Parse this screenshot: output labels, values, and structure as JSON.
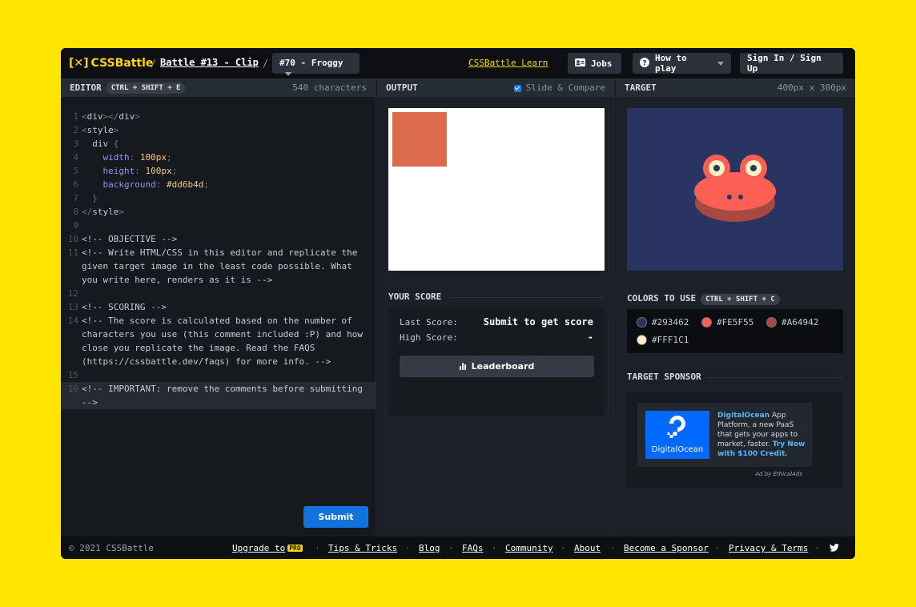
{
  "header": {
    "logo_text": "CSSBattle",
    "battle_link": "Battle #13 - Clip",
    "level_select": "#70 - Froggy",
    "learn_link": "CSSBattle Learn",
    "jobs_label": "Jobs",
    "how_to_play_label": "How to play",
    "sign_in_label": "Sign In / Sign Up"
  },
  "editor": {
    "title": "EDITOR",
    "shortcut": "CTRL + SHIFT + E",
    "char_count": "540 characters",
    "submit_label": "Submit",
    "lines": [
      {
        "n": "1"
      },
      {
        "n": "2"
      },
      {
        "n": "3"
      },
      {
        "n": "4"
      },
      {
        "n": "5"
      },
      {
        "n": "6"
      },
      {
        "n": "7"
      },
      {
        "n": "8"
      },
      {
        "n": "9"
      },
      {
        "n": "10",
        "text": "<!-- OBJECTIVE -->"
      },
      {
        "n": "11",
        "text": "<!-- Write HTML/CSS in this editor and replicate the given target image in the least code possible. What you write here, renders as it is -->"
      },
      {
        "n": "12"
      },
      {
        "n": "13",
        "text": "<!-- SCORING -->"
      },
      {
        "n": "14",
        "text": "<!-- The score is calculated based on the number of characters you use (this comment included :P) and how close you replicate the image. Read the FAQS (https://cssbattle.dev/faqs) for more info. -->"
      },
      {
        "n": "15"
      },
      {
        "n": "16",
        "text": "<!-- IMPORTANT: remove the comments before submitting -->"
      }
    ],
    "code": {
      "div_tag": "div",
      "style_tag": "style",
      "selector": "div",
      "width_prop": "width",
      "width_val": "100px",
      "height_prop": "height",
      "height_val": "100px",
      "bg_prop": "background",
      "bg_val": "#dd6b4d"
    }
  },
  "output": {
    "title": "OUTPUT",
    "slide_compare": "Slide & Compare",
    "div_color": "#dd6b4d"
  },
  "score": {
    "title": "YOUR SCORE",
    "last_label": "Last Score:",
    "last_value": "Submit to get score",
    "high_label": "High Score:",
    "high_value": "-",
    "leaderboard_label": "Leaderboard"
  },
  "target": {
    "title": "TARGET",
    "size": "400px x 300px",
    "colors_title": "COLORS TO USE",
    "colors_shortcut": "CTRL + SHIFT + C",
    "colors": [
      "#293462",
      "#FE5F55",
      "#A64942",
      "#FFF1C1"
    ],
    "sponsor_title": "TARGET SPONSOR"
  },
  "ad": {
    "logo_text": "DigitalOcean",
    "brand": "DigitalOcean",
    "body": " App Platform, a new PaaS that gets your apps to market, faster. ",
    "cta": "Try Now with $100 Credit.",
    "by": "Ad by EthicalAds"
  },
  "footer": {
    "copyright": "© 2021 CSSBattle",
    "upgrade": "Upgrade to",
    "pro_badge": "PRO",
    "tips": "Tips & Tricks",
    "blog": "Blog",
    "faqs": "FAQs",
    "community": "Community",
    "about": "About",
    "sponsor": "Become a Sponsor",
    "privacy": "Privacy & Terms",
    "dot": "·"
  },
  "colors": {
    "accent": "#FFD500",
    "background_frame": "#FFE500",
    "submit_blue": "#1273de"
  }
}
